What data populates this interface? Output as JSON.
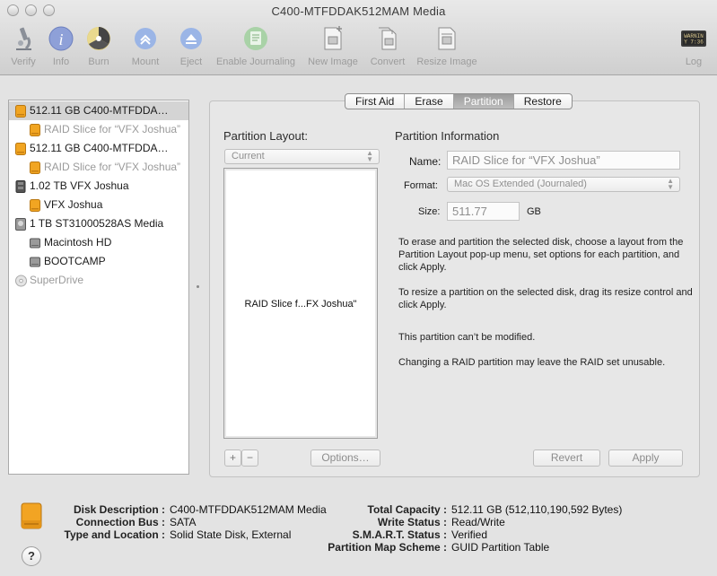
{
  "window": {
    "title": "C400-MTFDDAK512MAM Media"
  },
  "toolbar": {
    "verify": "Verify",
    "info": "Info",
    "burn": "Burn",
    "mount": "Mount",
    "eject": "Eject",
    "enable_journaling": "Enable Journaling",
    "new_image": "New Image",
    "convert": "Convert",
    "resize_image": "Resize Image",
    "log": "Log",
    "log_icon_text": "WARNIN\nY 7:36"
  },
  "sidebar": {
    "items": [
      {
        "label": "512.11 GB C400-MTFDDA…",
        "type": "disk"
      },
      {
        "label": "RAID Slice for “VFX Joshua”",
        "type": "volume"
      },
      {
        "label": "512.11 GB C400-MTFDDA…",
        "type": "disk"
      },
      {
        "label": "RAID Slice for “VFX Joshua”",
        "type": "volume"
      },
      {
        "label": "1.02 TB VFX Joshua",
        "type": "raid"
      },
      {
        "label": "VFX Joshua",
        "type": "volume"
      },
      {
        "label": "1 TB ST31000528AS Media",
        "type": "disk"
      },
      {
        "label": "Macintosh HD",
        "type": "volume"
      },
      {
        "label": "BOOTCAMP",
        "type": "volume"
      },
      {
        "label": "SuperDrive",
        "type": "optical"
      }
    ]
  },
  "tabs": [
    "First Aid",
    "Erase",
    "Partition",
    "Restore"
  ],
  "partition": {
    "layout_heading": "Partition Layout:",
    "layout_popup": "Current",
    "partition_label": "RAID Slice f...FX Joshua\"",
    "info_heading": "Partition Information",
    "name_label": "Name:",
    "name_value": "RAID Slice for “VFX Joshua”",
    "format_label": "Format:",
    "format_value": "Mac OS Extended (Journaled)",
    "size_label": "Size:",
    "size_value": "511.77",
    "size_unit": "GB",
    "help1": "To erase and partition the selected disk, choose a layout from the Partition Layout pop-up menu, set options for each partition, and click Apply.",
    "help2": "To resize a partition on the selected disk, drag its resize control and click Apply.",
    "help3": "This partition can’t be modified.",
    "help4": "Changing a RAID partition may leave the RAID set unusable.",
    "add": "+",
    "remove": "−",
    "options": "Options…",
    "revert": "Revert",
    "apply": "Apply"
  },
  "details": {
    "disk_description_label": "Disk Description :",
    "disk_description": "C400-MTFDDAK512MAM Media",
    "connection_bus_label": "Connection Bus :",
    "connection_bus": "SATA",
    "type_location_label": "Type and Location :",
    "type_location": "Solid State Disk, External",
    "total_capacity_label": "Total Capacity :",
    "total_capacity": "512.11 GB (512,110,190,592 Bytes)",
    "write_status_label": "Write Status :",
    "write_status": "Read/Write",
    "smart_status_label": "S.M.A.R.T. Status :",
    "smart_status": "Verified",
    "partition_map_label": "Partition Map Scheme :",
    "partition_map": "GUID Partition Table"
  },
  "help_button": "?",
  "colors": {
    "disk_orange": "#f0a020",
    "selection_grey": "#d4d4d4"
  }
}
